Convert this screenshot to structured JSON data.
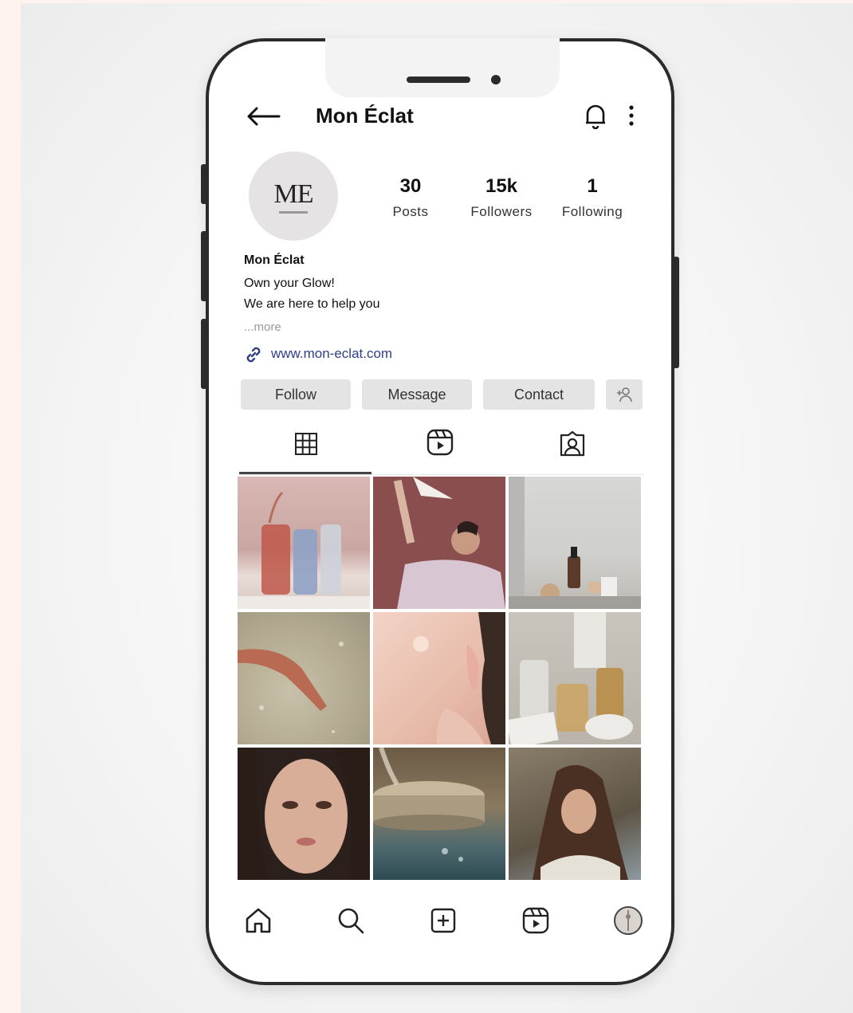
{
  "header": {
    "title": "Mon Éclat",
    "back_icon": "arrow-left-icon",
    "bell_icon": "bell-icon",
    "menu_icon": "more-vertical-icon"
  },
  "profile": {
    "avatar_monogram": "ME",
    "stats": [
      {
        "value": "30",
        "label": "Posts"
      },
      {
        "value": "15k",
        "label": "Followers"
      },
      {
        "value": "1",
        "label": "Following"
      }
    ],
    "name": "Mon Éclat",
    "bio_line1": "Own your Glow!",
    "bio_line2": "We are here to help you",
    "more": "...more",
    "website": "www.mon-eclat.com"
  },
  "actions": {
    "follow": "Follow",
    "message": "Message",
    "contact": "Contact"
  },
  "tabs": [
    "grid-icon",
    "reels-icon",
    "tagged-icon"
  ],
  "bottom_nav": [
    "home-icon",
    "search-icon",
    "add-post-icon",
    "reels-icon",
    "profile-avatar-icon"
  ],
  "colors": {
    "link": "#2f3f86",
    "button_bg": "#e4e4e4",
    "phone_frame": "#2b2b2b"
  }
}
